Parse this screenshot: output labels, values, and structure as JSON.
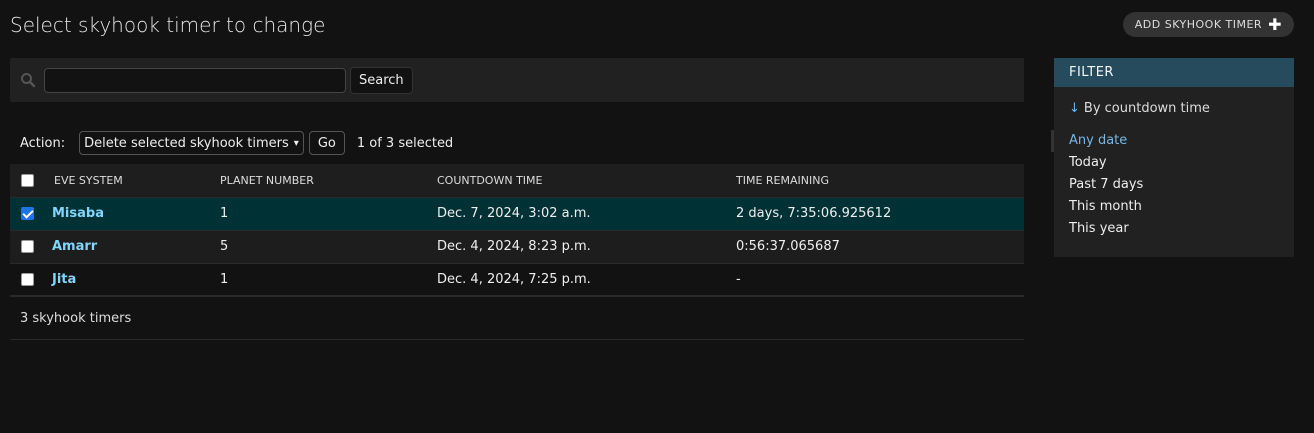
{
  "header": {
    "title": "Select skyhook timer to change",
    "add_label": "ADD SKYHOOK TIMER",
    "add_icon": "plus-icon"
  },
  "search": {
    "placeholder": "",
    "value": "",
    "button_label": "Search",
    "icon": "search-icon"
  },
  "actions": {
    "label": "Action:",
    "selected_action": "Delete selected skyhook timers",
    "go_label": "Go",
    "selection_status": "1 of 3 selected"
  },
  "table": {
    "columns": [
      "EVE SYSTEM",
      "PLANET NUMBER",
      "COUNTDOWN TIME",
      "TIME REMAINING"
    ],
    "rows": [
      {
        "system": "Misaba",
        "planet": "1",
        "countdown": "Dec. 7, 2024, 3:02 a.m.",
        "remaining": "2 days, 7:35:06.925612",
        "checked": true
      },
      {
        "system": "Amarr",
        "planet": "5",
        "countdown": "Dec. 4, 2024, 8:23 p.m.",
        "remaining": "0:56:37.065687",
        "checked": false
      },
      {
        "system": "Jita",
        "planet": "1",
        "countdown": "Dec. 4, 2024, 7:25 p.m.",
        "remaining": "-",
        "checked": false
      }
    ]
  },
  "footer": {
    "count_text": "3 skyhook timers"
  },
  "filter": {
    "title": "FILTER",
    "by_label": "By countdown time",
    "options": [
      "Any date",
      "Today",
      "Past 7 days",
      "This month",
      "This year"
    ],
    "selected": "Any date"
  },
  "colors": {
    "background": "#121212",
    "selected_row": "#003134",
    "filter_header": "#264b5d",
    "link": "#81d4fa",
    "checkbox_checked": "#1e73e8"
  }
}
